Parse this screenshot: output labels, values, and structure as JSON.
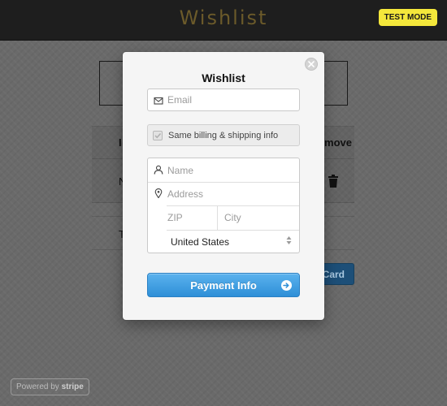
{
  "header": {
    "title": "Wishlist",
    "test_mode_badge": "TEST MODE"
  },
  "background_page": {
    "table_header_left": "I",
    "table_header_right": "move",
    "row1_left": "N",
    "row2_left": "T",
    "card_button_label": "Card",
    "powered_by": "Powered by",
    "powered_brand": "stripe"
  },
  "checkout": {
    "title": "Wishlist",
    "email_placeholder": "Email",
    "same_info_label": "Same billing & shipping info",
    "name_placeholder": "Name",
    "address_placeholder": "Address",
    "zip_placeholder": "ZIP",
    "city_placeholder": "City",
    "country_value": "United States",
    "pay_button_label": "Payment Info"
  },
  "colors": {
    "test_mode": "#f4e73b",
    "pay_button": "#3a9ae0",
    "header_bar": "#1e1e1e"
  },
  "icons": [
    "close-icon",
    "envelope-icon",
    "checkbox-icon",
    "person-icon",
    "location-pin-icon",
    "select-arrows-icon",
    "arrow-right-icon",
    "trash-icon"
  ]
}
